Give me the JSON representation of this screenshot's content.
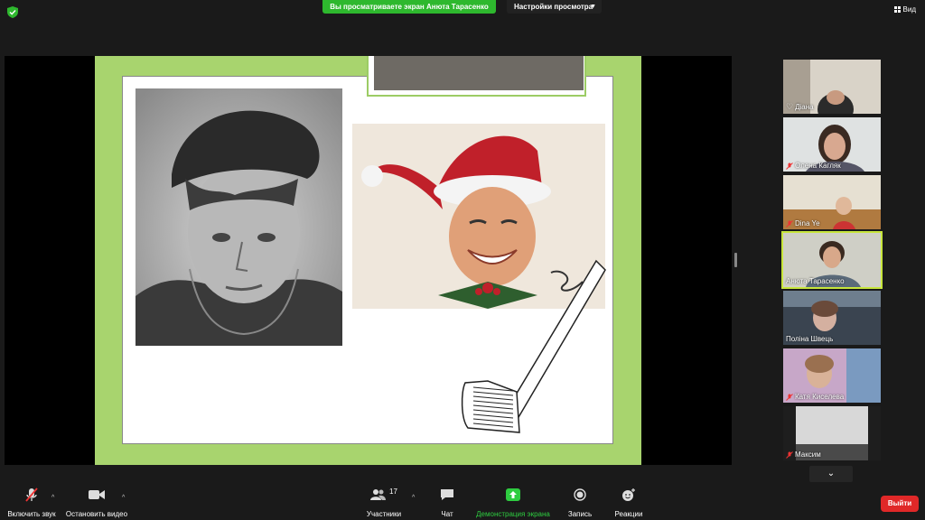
{
  "topbar": {
    "share_banner": "Вы просматриваете экран Анюта Тарасенко",
    "view_options": "Настройки просмотра",
    "view_button": "Вид"
  },
  "participants_panel": {
    "tiles": [
      {
        "name": "Діана",
        "muted": false
      },
      {
        "name": "Олена Кагляк",
        "muted": true
      },
      {
        "name": "Dina Ye",
        "muted": true
      },
      {
        "name": "Анюта Тарасенко",
        "muted": false,
        "active": true
      },
      {
        "name": "Поліна Швець",
        "muted": false
      },
      {
        "name": "Катя Киселева",
        "muted": true
      },
      {
        "name": "Максим",
        "muted": true
      }
    ]
  },
  "toolbar": {
    "audio": "Включить звук",
    "video": "Остановить видео",
    "participants": "Участники",
    "participants_count": "17",
    "chat": "Чат",
    "share": "Демонстрация экрана",
    "record": "Запись",
    "reactions": "Реакции",
    "leave": "Выйти"
  },
  "colors": {
    "share_green": "#2eb82e",
    "leave_red": "#e02828",
    "active_speaker": "#c8e63c",
    "slide_green": "#a8d46e"
  }
}
